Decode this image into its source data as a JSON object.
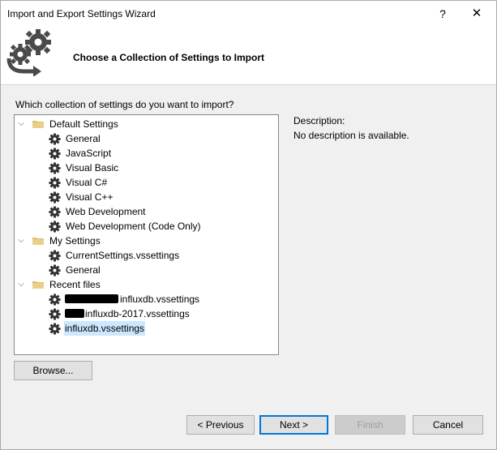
{
  "window": {
    "title": "Import and Export Settings Wizard",
    "help_glyph": "?",
    "close_glyph": "✕"
  },
  "header": {
    "title": "Choose a Collection of Settings to Import",
    "icon": "gears-arrow-icon"
  },
  "prompt": "Which collection of settings do you want to import?",
  "tree": {
    "groups": [
      {
        "label": "Default Settings",
        "expanded": true,
        "items": [
          "General",
          "JavaScript",
          "Visual Basic",
          "Visual C#",
          "Visual C++",
          "Web Development",
          "Web Development (Code Only)"
        ]
      },
      {
        "label": "My Settings",
        "expanded": true,
        "items": [
          "CurrentSettings.vssettings",
          "General"
        ]
      },
      {
        "label": "Recent files",
        "expanded": true,
        "items": [
          "influxdb.vssettings",
          "influxdb-2017.vssettings",
          "influxdb.vssettings"
        ],
        "selected_index": 2
      }
    ]
  },
  "description": {
    "label": "Description:",
    "value": "No description is available."
  },
  "buttons": {
    "browse": "Browse...",
    "previous": "< Previous",
    "next": "Next >",
    "finish": "Finish",
    "cancel": "Cancel"
  },
  "colors": {
    "selection": "#cce8ff",
    "folder": "#dcc06f",
    "accent": "#0078d7"
  }
}
